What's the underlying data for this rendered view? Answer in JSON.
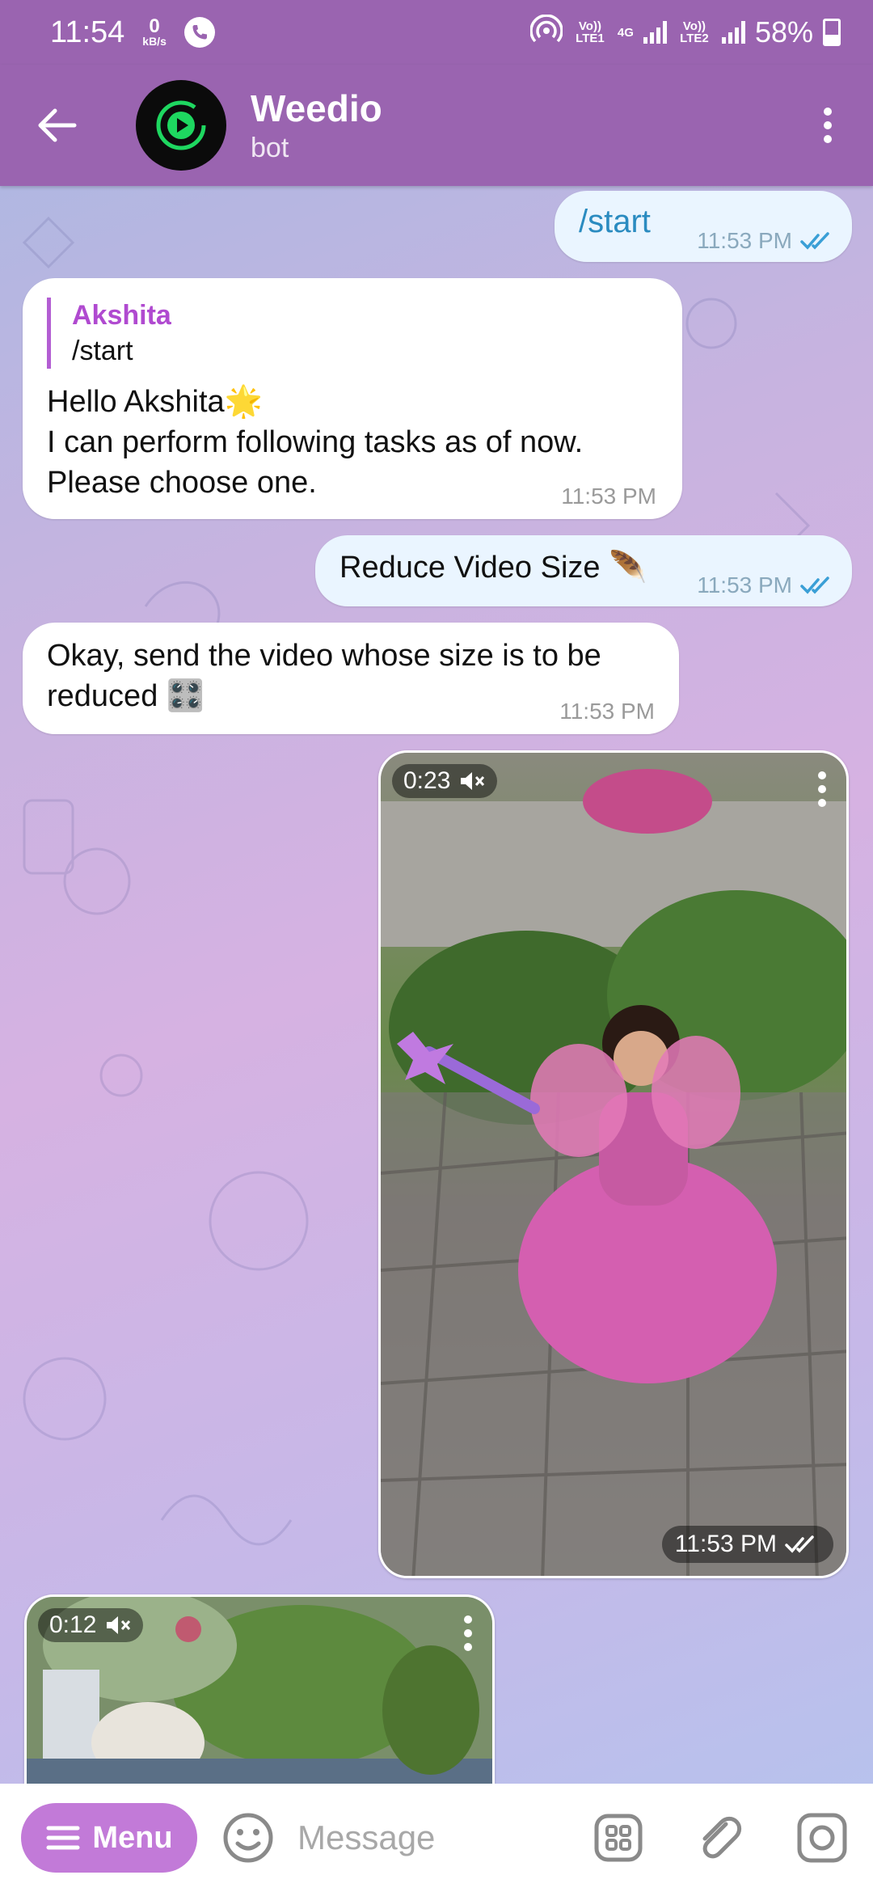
{
  "status": {
    "time": "11:54",
    "kbs_value": "0",
    "kbs_unit": "kB/s",
    "net1": "Vo)) LTE1",
    "net_type": "4G",
    "net2": "Vo)) LTE2",
    "battery": "58%"
  },
  "header": {
    "title": "Weedio",
    "subtitle": "bot"
  },
  "messages": {
    "m1": {
      "text": "/start",
      "time": "11:53 PM"
    },
    "m2": {
      "reply_name": "Akshita",
      "reply_text": "/start",
      "line1": "Hello Akshita🌟",
      "line2": "I can perform following tasks as of now.",
      "line3": "Please choose one.",
      "time": "11:53 PM"
    },
    "m3": {
      "text": "Reduce Video Size 🪶",
      "time": "11:53 PM"
    },
    "m4": {
      "line1": "Okay, send the video whose size is to be",
      "line2": "reduced 🎛️",
      "time": "11:53 PM"
    },
    "v1": {
      "duration": "0:23",
      "time": "11:53 PM"
    },
    "v2": {
      "duration": "0:12"
    }
  },
  "input": {
    "menu_label": "Menu",
    "placeholder": "Message"
  },
  "colors": {
    "header": "#9a64b0",
    "menu_pill": "#c27ad8",
    "outgoing_bubble": "#eaf5ff",
    "link_blue": "#2a8bc0"
  }
}
